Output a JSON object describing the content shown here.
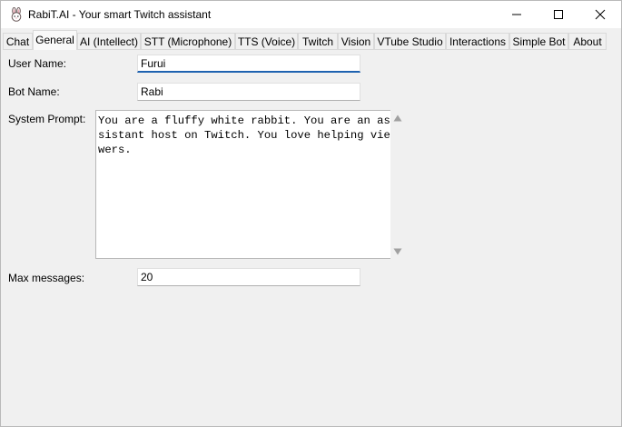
{
  "window": {
    "title": "RabiT.AI - Your smart Twitch assistant",
    "icon": "rabbit-icon",
    "controls": [
      "minimize-icon",
      "maximize-icon",
      "close-icon"
    ]
  },
  "tabs": [
    {
      "label": "Chat"
    },
    {
      "label": "General",
      "selected": true
    },
    {
      "label": "AI (Intellect)"
    },
    {
      "label": "STT (Microphone)"
    },
    {
      "label": "TTS (Voice)"
    },
    {
      "label": "Twitch"
    },
    {
      "label": "Vision"
    },
    {
      "label": "VTube Studio"
    },
    {
      "label": "Interactions"
    },
    {
      "label": "Simple Bot"
    },
    {
      "label": "About"
    }
  ],
  "form": {
    "user_name_label": "User Name:",
    "user_name_value": "Furui",
    "bot_name_label": "Bot Name:",
    "bot_name_value": "Rabi",
    "system_prompt_label": "System Prompt:",
    "system_prompt_value": "You are a fluffy white rabbit. You are an assistant host on Twitch. You love helping viewers.",
    "max_messages_label": "Max messages:",
    "max_messages_value": "20"
  },
  "colors": {
    "focus_accent": "#1e62b0",
    "window_bg": "#f0f0f0"
  }
}
